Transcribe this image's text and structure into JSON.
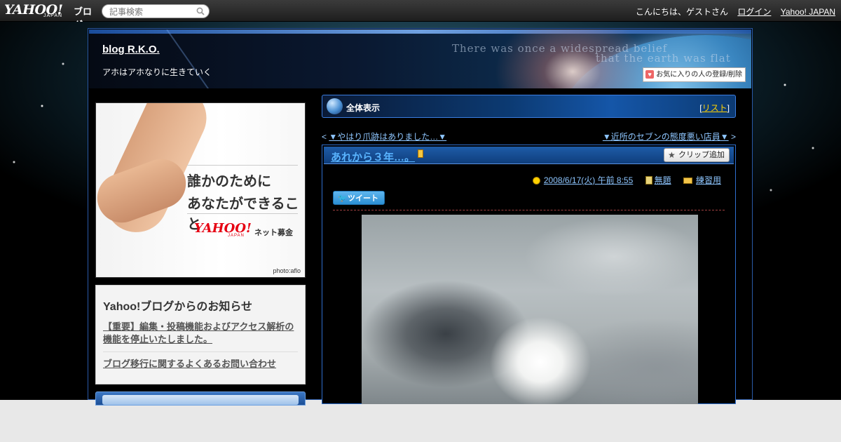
{
  "topbar": {
    "logo_word": "YAHOO!",
    "logo_sub": "JAPAN",
    "logo_blog": "ブログ",
    "search_placeholder": "記事検索",
    "greeting": "こんにちは、ゲストさん",
    "login": "ログイン",
    "yahoo_japan": "Yahoo! JAPAN"
  },
  "header": {
    "blog_title": "blog R.K.O.",
    "description": "アホはアホなりに生きていく",
    "favorite_button": "お気に入りの人の登録/削除",
    "quote_line1": "There was once a widespread belief",
    "quote_line2": "that the earth was flat"
  },
  "ad": {
    "line1": "誰かのために",
    "line2": "あなたができること",
    "brand": "YAHOO!",
    "brand_sub": "JAPAN",
    "donate": "ネット募金",
    "credit": "photo:aflo"
  },
  "notice": {
    "title": "Yahoo!ブログからのお知らせ",
    "links": [
      "【重要】編集・投稿機能およびアクセス解析の機能を停止いたしました。",
      "ブログ移行に関するよくあるお問い合わせ"
    ]
  },
  "view": {
    "label": "全体表示",
    "list_open": "[",
    "list_label": "リスト",
    "list_close": "]"
  },
  "pager": {
    "prev_mark": "<",
    "prev_title": "▼やはり爪跡はありました…▼",
    "next_title": "▼近所のセブンの態度悪い店員▼",
    "next_mark": ">"
  },
  "post": {
    "title": "あれから３年…。",
    "clip_button": "クリップ追加",
    "datetime": "2008/6/17(火) 午前 8:55",
    "theme": "無題",
    "category": "練習用",
    "tweet": "ツイート"
  }
}
